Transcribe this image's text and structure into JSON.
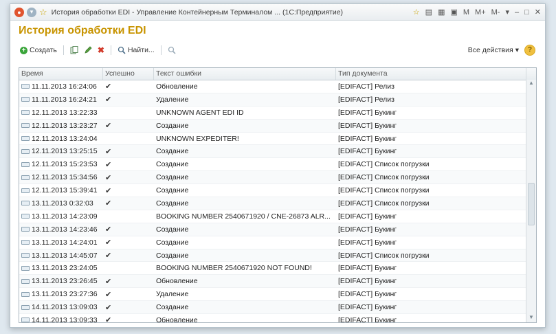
{
  "window": {
    "title": "История обработки EDI - Управление Контейнерным Терминалом ... (1С:Предприятие)",
    "right_items": [
      "M",
      "M+",
      "M-"
    ]
  },
  "heading": "История обработки EDI",
  "toolbar": {
    "create_label": "Создать",
    "find_label": "Найти...",
    "all_actions_label": "Все действия",
    "help_label": "?"
  },
  "grid": {
    "columns": [
      "Время",
      "Успешно",
      "Текст ошибки",
      "Тип документа"
    ],
    "rows": [
      {
        "time": "11.11.2013 16:24:06",
        "ok": "✔",
        "error": "Обновление",
        "doc": "[EDIFACT] Релиз"
      },
      {
        "time": "11.11.2013 16:24:21",
        "ok": "✔",
        "error": "Удаление",
        "doc": "[EDIFACT] Релиз"
      },
      {
        "time": "12.11.2013 13:22:33",
        "ok": "",
        "error": "UNKNOWN AGENT EDI ID",
        "doc": "[EDIFACT] Букинг"
      },
      {
        "time": "12.11.2013 13:23:27",
        "ok": "✔",
        "error": "Создание",
        "doc": "[EDIFACT] Букинг"
      },
      {
        "time": "12.11.2013 13:24:04",
        "ok": "",
        "error": "UNKNOWN EXPEDITER!",
        "doc": "[EDIFACT] Букинг"
      },
      {
        "time": "12.11.2013 13:25:15",
        "ok": "✔",
        "error": "Создание",
        "doc": "[EDIFACT] Букинг"
      },
      {
        "time": "12.11.2013 15:23:53",
        "ok": "✔",
        "error": "Создание",
        "doc": "[EDIFACT] Список погрузки"
      },
      {
        "time": "12.11.2013 15:34:56",
        "ok": "✔",
        "error": "Создание",
        "doc": "[EDIFACT] Список погрузки"
      },
      {
        "time": "12.11.2013 15:39:41",
        "ok": "✔",
        "error": "Создание",
        "doc": "[EDIFACT] Список погрузки"
      },
      {
        "time": "13.11.2013 0:32:03",
        "ok": "✔",
        "error": "Создание",
        "doc": "[EDIFACT] Список погрузки"
      },
      {
        "time": "13.11.2013 14:23:09",
        "ok": "",
        "error": "BOOKING NUMBER 2540671920 / CNE-26873 ALR...",
        "doc": "[EDIFACT] Букинг"
      },
      {
        "time": "13.11.2013 14:23:46",
        "ok": "✔",
        "error": "Создание",
        "doc": "[EDIFACT] Букинг"
      },
      {
        "time": "13.11.2013 14:24:01",
        "ok": "✔",
        "error": "Создание",
        "doc": "[EDIFACT] Букинг"
      },
      {
        "time": "13.11.2013 14:45:07",
        "ok": "✔",
        "error": "Создание",
        "doc": "[EDIFACT] Список погрузки"
      },
      {
        "time": "13.11.2013 23:24:05",
        "ok": "",
        "error": "BOOKING NUMBER 2540671920 NOT FOUND!",
        "doc": "[EDIFACT] Букинг"
      },
      {
        "time": "13.11.2013 23:26:45",
        "ok": "✔",
        "error": "Обновление",
        "doc": "[EDIFACT] Букинг"
      },
      {
        "time": "13.11.2013 23:27:36",
        "ok": "✔",
        "error": "Удаление",
        "doc": "[EDIFACT] Букинг"
      },
      {
        "time": "14.11.2013 13:09:03",
        "ok": "✔",
        "error": "Создание",
        "doc": "[EDIFACT] Букинг"
      },
      {
        "time": "14.11.2013 13:09:33",
        "ok": "✔",
        "error": "Обновление",
        "doc": "[EDIFACT] Букинг"
      }
    ]
  }
}
